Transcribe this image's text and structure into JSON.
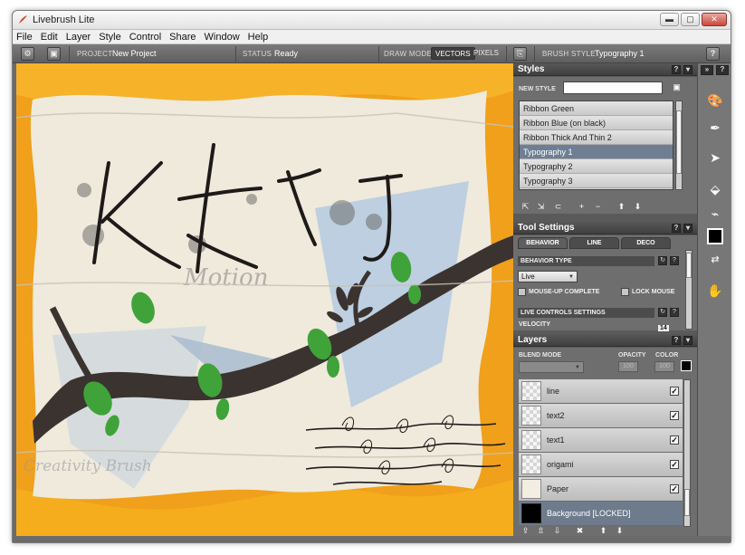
{
  "window": {
    "title": "Livebrush Lite",
    "minimize": "▬",
    "maximize": "▢",
    "close": "✕"
  },
  "menu": [
    "File",
    "Edit",
    "Layer",
    "Style",
    "Control",
    "Share",
    "Window",
    "Help"
  ],
  "toolbar": {
    "project_label": "PROJECT",
    "project_name": "New Project",
    "status_label": "STATUS",
    "status_value": "Ready",
    "draw_mode_label": "DRAW MODE",
    "mode_vectors": "VECTORS",
    "mode_pixels": "PIXELS",
    "brush_style_label": "BRUSH STYLE",
    "brush_style_value": "Typography 1",
    "help": "?"
  },
  "styles_panel": {
    "title": "Styles",
    "new_style_label": "NEW STYLE",
    "new_style_value": "",
    "items": [
      "Ribbon Green",
      "Ribbon Blue (on black)",
      "Ribbon Thick And Thin 2",
      "Typography 1",
      "Typography 2",
      "Typography 3"
    ],
    "selected": "Typography 1"
  },
  "tool_settings": {
    "title": "Tool Settings",
    "tabs": [
      "BEHAVIOR",
      "LINE",
      "DECO"
    ],
    "active_tab": "BEHAVIOR",
    "behavior_type_label": "BEHAVIOR TYPE",
    "behavior_type_value": "Live",
    "mouse_up_complete": "MOUSE-UP COMPLETE",
    "lock_mouse": "LOCK MOUSE",
    "live_controls_label": "LIVE CONTROLS SETTINGS",
    "velocity_label": "VELOCITY",
    "velocity_value": "14"
  },
  "layers_panel": {
    "title": "Layers",
    "blend_mode_label": "BLEND MODE",
    "opacity_label": "OPACITY",
    "color_label": "COLOR",
    "opacity_value": "100",
    "color_value": "100",
    "layers": [
      {
        "name": "line",
        "checked": "✓"
      },
      {
        "name": "text2",
        "checked": "✓"
      },
      {
        "name": "text1",
        "checked": "✓"
      },
      {
        "name": "origami",
        "checked": "✓"
      },
      {
        "name": "Paper",
        "checked": "✓"
      },
      {
        "name": "Background [LOCKED]",
        "checked": ""
      }
    ],
    "selected": "Background [LOCKED]"
  },
  "canvas_text": {
    "title_glyphs": "KATOJ",
    "motion": "Motion",
    "creativity": "Creativity Brush"
  },
  "colors": {
    "accent_orange": "#f2a418",
    "paper": "#efeadc",
    "panel_dark": "#585858",
    "selected_row": "#6f7f93",
    "leaf_green": "#3fa33a",
    "branch": "#3b3330"
  }
}
